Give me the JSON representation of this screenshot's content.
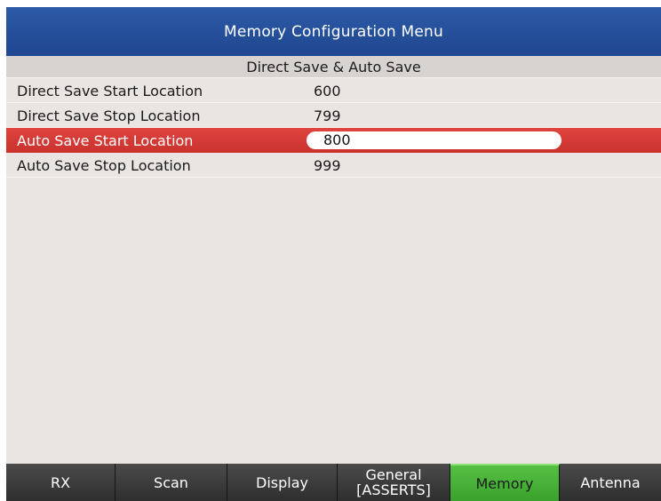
{
  "window": {
    "title": "Memory Configuration Menu"
  },
  "section": {
    "title": "Direct Save & Auto Save"
  },
  "settings": [
    {
      "label": "Direct Save Start Location",
      "value": "600",
      "selected": false
    },
    {
      "label": "Direct Save Stop Location",
      "value": "799",
      "selected": false
    },
    {
      "label": "Auto Save Start Location",
      "value": "800",
      "selected": true
    },
    {
      "label": "Auto Save Stop Location",
      "value": "999",
      "selected": false
    }
  ],
  "tabs": [
    {
      "label": "RX",
      "active": false
    },
    {
      "label": "Scan",
      "active": false
    },
    {
      "label": "Display",
      "active": false
    },
    {
      "label": "General",
      "sublabel": "[ASSERTS]",
      "active": false
    },
    {
      "label": "Memory",
      "active": true
    },
    {
      "label": "Antenna",
      "active": false
    }
  ],
  "colors": {
    "title_bar": "#2453a0",
    "selected_row": "#d63b36",
    "active_tab": "#48b13a",
    "background": "#e9e5e3"
  }
}
